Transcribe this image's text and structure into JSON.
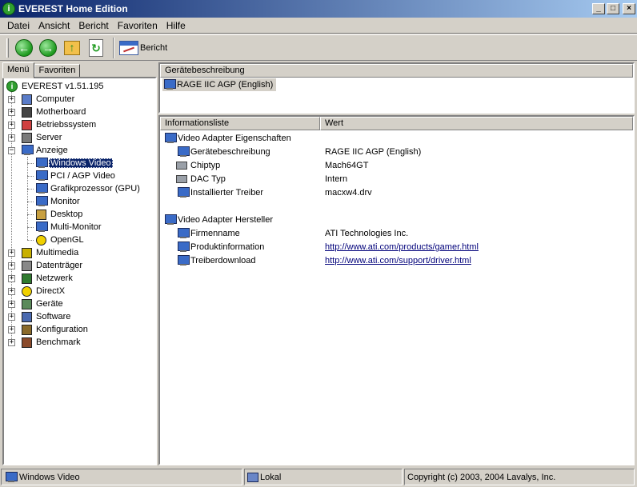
{
  "window": {
    "title": "EVEREST Home Edition"
  },
  "menubar": [
    {
      "label": "Datei"
    },
    {
      "label": "Ansicht"
    },
    {
      "label": "Bericht"
    },
    {
      "label": "Favoriten"
    },
    {
      "label": "Hilfe"
    }
  ],
  "toolbar": {
    "report_label": "Bericht"
  },
  "tabs": [
    {
      "label": "Menü",
      "active": true
    },
    {
      "label": "Favoriten",
      "active": false
    }
  ],
  "tree": {
    "root": "EVEREST v1.51.195",
    "items": [
      {
        "label": "Computer",
        "icon": "computer-icon"
      },
      {
        "label": "Motherboard",
        "icon": "motherboard-icon"
      },
      {
        "label": "Betriebssystem",
        "icon": "windows-icon"
      },
      {
        "label": "Server",
        "icon": "server-icon"
      },
      {
        "label": "Anzeige",
        "icon": "display-icon",
        "expanded": true,
        "children": [
          {
            "label": "Windows Video",
            "icon": "monitor-icon",
            "selected": true
          },
          {
            "label": "PCI / AGP Video",
            "icon": "monitor-icon"
          },
          {
            "label": "Grafikprozessor (GPU)",
            "icon": "monitor-icon"
          },
          {
            "label": "Monitor",
            "icon": "monitor-icon"
          },
          {
            "label": "Desktop",
            "icon": "desktop-icon"
          },
          {
            "label": "Multi-Monitor",
            "icon": "monitor-icon"
          },
          {
            "label": "OpenGL",
            "icon": "opengl-icon"
          }
        ]
      },
      {
        "label": "Multimedia",
        "icon": "speaker-icon"
      },
      {
        "label": "Datenträger",
        "icon": "drive-icon"
      },
      {
        "label": "Netzwerk",
        "icon": "network-icon"
      },
      {
        "label": "DirectX",
        "icon": "directx-icon"
      },
      {
        "label": "Geräte",
        "icon": "devices-icon"
      },
      {
        "label": "Software",
        "icon": "software-icon"
      },
      {
        "label": "Konfiguration",
        "icon": "config-icon"
      },
      {
        "label": "Benchmark",
        "icon": "hourglass-icon"
      }
    ]
  },
  "device_panel": {
    "header": "Gerätebeschreibung",
    "device": "RAGE IIC AGP (English)"
  },
  "info_panel": {
    "columns": [
      "Informationsliste",
      "Wert"
    ],
    "groups": [
      {
        "title": "Video Adapter Eigenschaften",
        "rows": [
          {
            "field": "Gerätebeschreibung",
            "value": "RAGE IIC AGP (English)",
            "icon": "monitor-icon"
          },
          {
            "field": "Chiptyp",
            "value": "Mach64GT",
            "icon": "chip-icon"
          },
          {
            "field": "DAC Typ",
            "value": "Intern",
            "icon": "chip-icon"
          },
          {
            "field": "Installierter Treiber",
            "value": "macxw4.drv",
            "icon": "monitor-icon"
          }
        ]
      },
      {
        "title": "Video Adapter Hersteller",
        "rows": [
          {
            "field": "Firmenname",
            "value": "ATI Technologies Inc.",
            "icon": "monitor-icon"
          },
          {
            "field": "Produktinformation",
            "value": "http://www.ati.com/products/gamer.html",
            "icon": "monitor-icon",
            "link": true
          },
          {
            "field": "Treiberdownload",
            "value": "http://www.ati.com/support/driver.html",
            "icon": "monitor-icon",
            "link": true
          }
        ]
      }
    ]
  },
  "statusbar": {
    "section": "Windows Video",
    "location": "Lokal",
    "copyright": "Copyright (c) 2003, 2004 Lavalys, Inc."
  }
}
